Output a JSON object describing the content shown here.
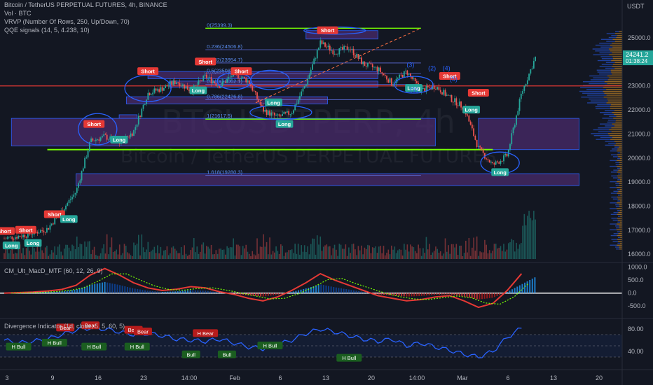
{
  "header": {
    "title_line": "Bitcoin / TetherUS PERPETUAL FUTURES, 4h, BINANCE",
    "vol_line": "Vol · BTC",
    "vrvp_line": "VRVP (Number Of Rows, 250, Up/Down, 70)",
    "qqe_line": "QQE signals (14, 5, 4.238, 10)",
    "currency": "USDT"
  },
  "watermark": {
    "ticker": "BTCUSDTPERP, 4h",
    "name": "Bitcoin / TetherUS PERPETUAL FUTURES"
  },
  "colors": {
    "background": "#131722",
    "up": "#26a69a",
    "down": "#ef5350",
    "fib_line": "#2962ff",
    "support_line": "#76ff03",
    "zone": "#4a2b6b",
    "macd_line": "#e53935",
    "divergence_line": "#2962ff"
  },
  "price_label": {
    "price": "24241.2",
    "countdown": "01:38:24"
  },
  "chart_data": {
    "type": "line",
    "price_axis": {
      "ticks": [
        "25000.0",
        "24000.0",
        "23000.0",
        "22000.0",
        "21000.0",
        "20000.0",
        "19000.0",
        "18000.0",
        "17000.0",
        "16000.0"
      ],
      "ylim": [
        15800,
        25700
      ]
    },
    "x_axis": {
      "ticks": [
        "3",
        "9",
        "16",
        "23",
        "14:00",
        "Feb",
        "6",
        "13",
        "20",
        "14:00",
        "Mar",
        "6",
        "13",
        "20"
      ]
    },
    "price_path": {
      "x": [
        0,
        3,
        6,
        8,
        10,
        12,
        14,
        16,
        18,
        20,
        22,
        24,
        26,
        28,
        30,
        32,
        34,
        36,
        38,
        40,
        42,
        44,
        46,
        48,
        50,
        52,
        54,
        56,
        58,
        60,
        62,
        64,
        66,
        68,
        70,
        72,
        74
      ],
      "close": [
        16650,
        16800,
        17050,
        17800,
        18600,
        20700,
        20900,
        20600,
        21100,
        22700,
        22900,
        23200,
        22800,
        23400,
        23000,
        23500,
        23200,
        22000,
        21700,
        21900,
        23100,
        24800,
        24400,
        24600,
        23900,
        23700,
        23100,
        23600,
        22800,
        23000,
        22500,
        22100,
        20400,
        19700,
        20100,
        22700,
        24240
      ]
    },
    "fib_levels": [
      {
        "label": "0(25399.3)",
        "value": 25399.3
      },
      {
        "label": "0.236(24506.8)",
        "value": 24506.8
      },
      {
        "label": "0.382(23954.7)",
        "value": 23954.7
      },
      {
        "label": "0.5(23508.4)",
        "value": 23508.4
      },
      {
        "label": "0.618(23062.1)",
        "value": 23062.1
      },
      {
        "label": "0.786(22426.8)",
        "value": 22426.8
      },
      {
        "label": "1(21617.5)",
        "value": 21617.5
      },
      {
        "label": "1.618(19280.3)",
        "value": 19280.3
      }
    ],
    "horizontal_levels": [
      23000,
      20350
    ],
    "signals": [
      {
        "text": "Short",
        "x": 0,
        "price": 16950,
        "kind": "short"
      },
      {
        "text": "Long",
        "x": 1,
        "price": 16350,
        "kind": "long"
      },
      {
        "text": "Short",
        "x": 3,
        "price": 17000,
        "kind": "short"
      },
      {
        "text": "Long",
        "x": 4,
        "price": 16450,
        "kind": "long"
      },
      {
        "text": "Short",
        "x": 7,
        "price": 17650,
        "kind": "short"
      },
      {
        "text": "Long",
        "x": 9,
        "price": 17450,
        "kind": "long"
      },
      {
        "text": "Short",
        "x": 12.5,
        "price": 21400,
        "kind": "short"
      },
      {
        "text": "Long",
        "x": 16,
        "price": 20750,
        "kind": "long"
      },
      {
        "text": "Short",
        "x": 20,
        "price": 23600,
        "kind": "short"
      },
      {
        "text": "Short",
        "x": 28,
        "price": 24000,
        "kind": "short"
      },
      {
        "text": "Long",
        "x": 27,
        "price": 22800,
        "kind": "long"
      },
      {
        "text": "Short",
        "x": 33,
        "price": 23600,
        "kind": "short"
      },
      {
        "text": "Long",
        "x": 37.5,
        "price": 22300,
        "kind": "long"
      },
      {
        "text": "Long",
        "x": 39,
        "price": 21400,
        "kind": "long"
      },
      {
        "text": "Short",
        "x": 45,
        "price": 25300,
        "kind": "short"
      },
      {
        "text": "Long",
        "x": 57,
        "price": 22900,
        "kind": "long"
      },
      {
        "text": "Short",
        "x": 62,
        "price": 23400,
        "kind": "short"
      },
      {
        "text": "Long",
        "x": 65,
        "price": 22000,
        "kind": "long"
      },
      {
        "text": "Short",
        "x": 66,
        "price": 22700,
        "kind": "short"
      },
      {
        "text": "Long",
        "x": 69,
        "price": 19400,
        "kind": "long"
      }
    ],
    "wave_labels": [
      "(1)",
      "(2)",
      "(3)",
      "(4)",
      "(5)"
    ],
    "macd": {
      "title": "CM_Ult_MacD_MTF (60, 12, 26, 9)",
      "ticks": [
        "1000.0",
        "500.0",
        "0.0",
        "-500.0"
      ],
      "ylim": [
        -900,
        1100
      ],
      "line": [
        0,
        20,
        40,
        80,
        140,
        300,
        700,
        950,
        700,
        400,
        200,
        100,
        150,
        250,
        200,
        50,
        -50,
        -200,
        -300,
        -150,
        100,
        400,
        750,
        500,
        300,
        100,
        -100,
        -200,
        -300,
        -250,
        -150,
        -100,
        -300,
        -550,
        -400,
        100,
        750
      ]
    },
    "divergence": {
      "title": "Divergence Indicator (1d, close, 5, 5, 60, 5)",
      "ticks": [
        "80.00",
        "40.00"
      ],
      "ylim": [
        10,
        95
      ],
      "line": [
        60,
        55,
        58,
        62,
        70,
        78,
        82,
        80,
        75,
        70,
        72,
        68,
        62,
        60,
        58,
        62,
        55,
        48,
        45,
        52,
        60,
        72,
        80,
        75,
        68,
        62,
        58,
        62,
        50,
        55,
        48,
        42,
        35,
        30,
        40,
        65,
        82
      ],
      "labels": [
        {
          "text": "H Bull",
          "x": 2,
          "value": 48,
          "kind": "bull"
        },
        {
          "text": "H Bull",
          "x": 7,
          "value": 55,
          "kind": "bull"
        },
        {
          "text": "Bear",
          "x": 8.5,
          "value": 82,
          "kind": "bear"
        },
        {
          "text": "Bear",
          "x": 12,
          "value": 86,
          "kind": "bear"
        },
        {
          "text": "H Bull",
          "x": 12.5,
          "value": 48,
          "kind": "bull"
        },
        {
          "text": "Bear",
          "x": 18,
          "value": 78,
          "kind": "bear"
        },
        {
          "text": "Bear",
          "x": 19.3,
          "value": 75,
          "kind": "bear"
        },
        {
          "text": "H Bull",
          "x": 18.5,
          "value": 48,
          "kind": "bull"
        },
        {
          "text": "H Bear",
          "x": 28,
          "value": 72,
          "kind": "bear"
        },
        {
          "text": "Bull",
          "x": 26,
          "value": 34,
          "kind": "bull"
        },
        {
          "text": "Bull",
          "x": 31,
          "value": 34,
          "kind": "bull"
        },
        {
          "text": "H Bull",
          "x": 37,
          "value": 50,
          "kind": "bull"
        },
        {
          "text": "H Bull",
          "x": 48,
          "value": 28,
          "kind": "bull"
        }
      ]
    }
  }
}
